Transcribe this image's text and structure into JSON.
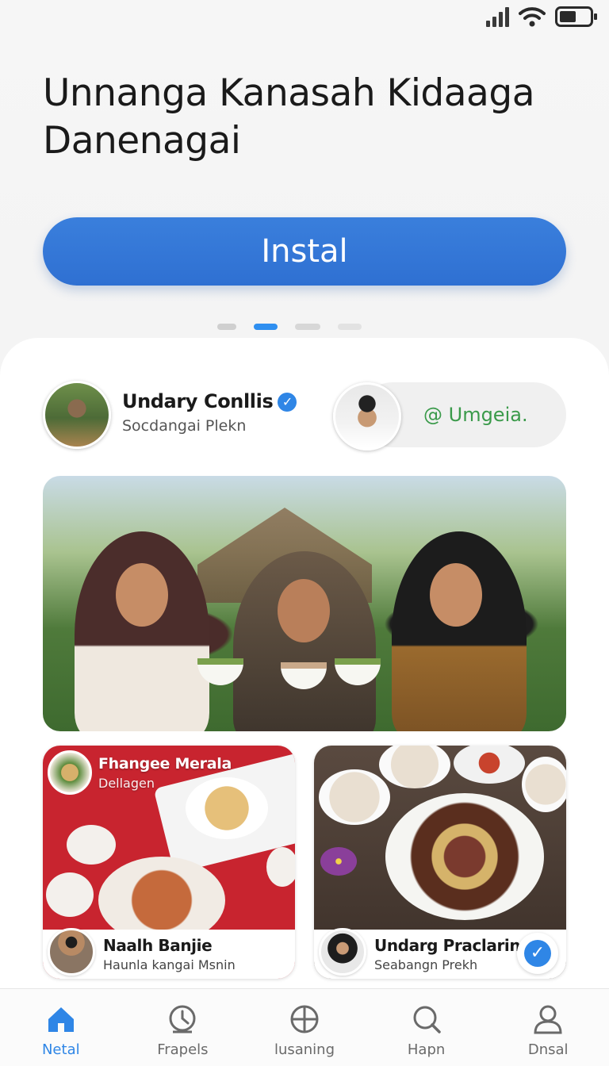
{
  "hero": {
    "title_line1": "Unnanga Kanasah Kidaaga",
    "title_line2": "Danenagai",
    "install_label": "Instal"
  },
  "carousel": {
    "pages": 4,
    "active_index": 1
  },
  "profile": {
    "name": "Undary Conllis",
    "handle": "Socdangai Plekn",
    "verified": true,
    "mention": "@ Umgeia."
  },
  "cards": [
    {
      "tag_title": "Fhangee Merala",
      "tag_subtitle": "Dellagen",
      "footer_name": "Naalh Banjie",
      "footer_subtitle": "Haunla kangai Msnin"
    },
    {
      "footer_name": "Undarg Praclarin",
      "footer_subtitle": "Seabangn Prekh"
    }
  ],
  "tabs": [
    {
      "label": "Netal",
      "icon": "home-icon",
      "active": true
    },
    {
      "label": "Frapels",
      "icon": "clock-icon",
      "active": false
    },
    {
      "label": "lusaning",
      "icon": "grid-icon",
      "active": false
    },
    {
      "label": "Hapn",
      "icon": "search-icon",
      "active": false
    },
    {
      "label": "Dnsal",
      "icon": "person-icon",
      "active": false
    }
  ],
  "colors": {
    "accent": "#2f86e6",
    "install_button": "#3278d8",
    "mention_text": "#3a9a4a"
  }
}
